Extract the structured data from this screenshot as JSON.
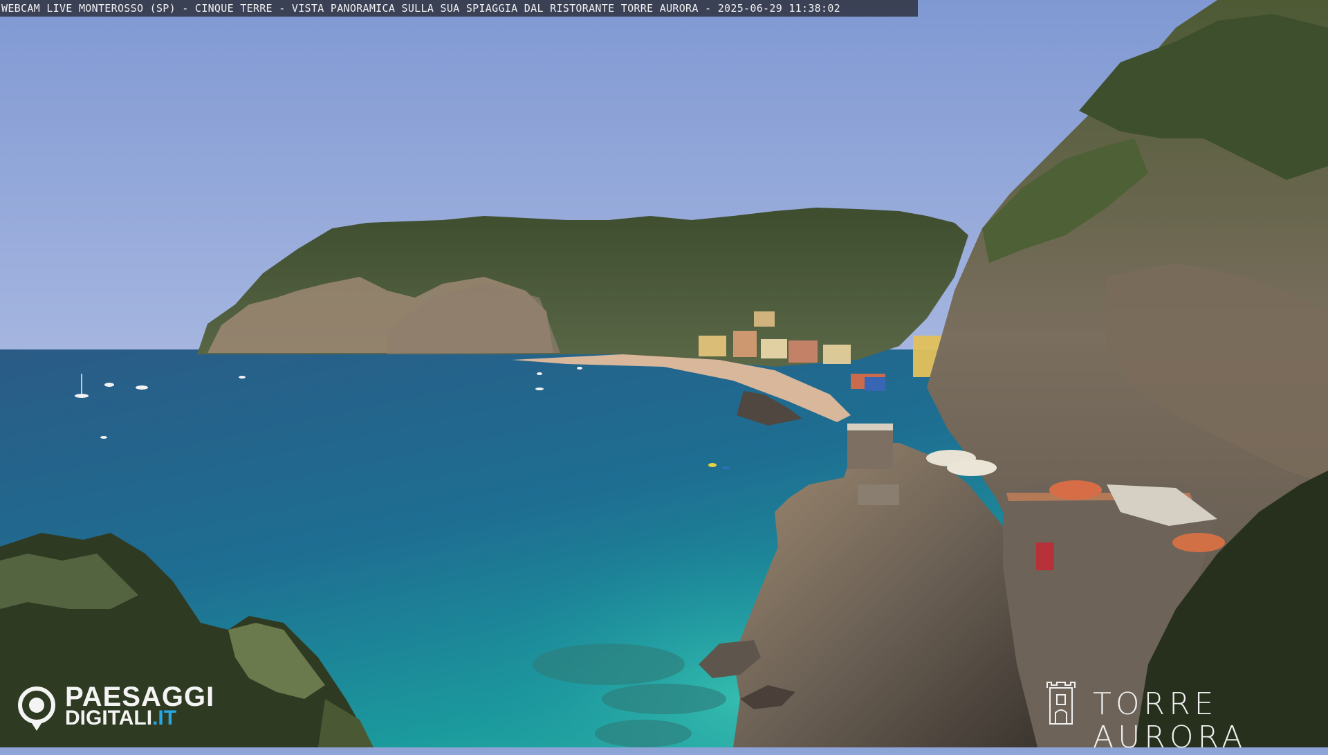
{
  "overlay": {
    "caption": "WEBCAM LIVE MONTEROSSO (SP) - CINQUE TERRE - VISTA PANORAMICA SULLA SUA SPIAGGIA DAL RISTORANTE TORRE AURORA - 2025-06-29 11:38:02"
  },
  "branding": {
    "left_logo_line1": "PAESAGGI",
    "left_logo_line2_main": "DIGITALI",
    "left_logo_line2_suffix": ".IT",
    "left_logo_icon": "camera-pin-icon",
    "right_logo_text": "TORRE AURORA",
    "right_logo_icon": "tower-icon"
  },
  "colors": {
    "sky": "#8ea4d6",
    "sea_deep": "#1f5d8a",
    "sea_shallow": "#2aa7a8",
    "hills": "#4a5a36",
    "cliff": "#8a7b6a",
    "accent_blue": "#27a7e6"
  }
}
